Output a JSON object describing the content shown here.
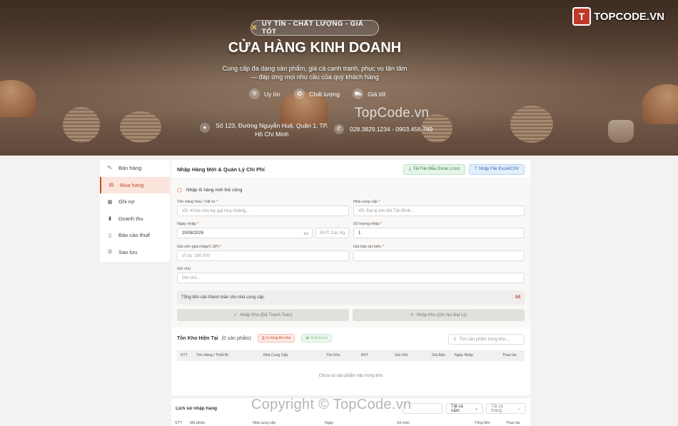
{
  "brand": {
    "logo_mark": "T",
    "logo_text": "TOPCODE.VN",
    "hero_watermark": "TopCode.vn",
    "footer_watermark": "Copyright © TopCode.vn"
  },
  "hero": {
    "tagline": "UY TÍN - CHẤT LƯỢNG - GIÁ TỐT",
    "title": "CỬA HÀNG KINH DOANH",
    "description": "Cung cấp đa dạng sản phẩm, giá cả cạnh tranh, phục vụ tận tâm — đáp ứng mọi nhu cầu của quý khách hàng",
    "badges": [
      {
        "label": "Uy tín",
        "icon": "shield-icon"
      },
      {
        "label": "Chất lượng",
        "icon": "medal-icon"
      },
      {
        "label": "Giá tốt",
        "icon": "truck-icon"
      }
    ],
    "address": "Số 123, Đường Nguyễn Huệ, Quận 1, TP. Hồ Chí Minh",
    "phone": "028.3829.1234 - 0903.456.789"
  },
  "sidebar": {
    "items": [
      {
        "label": "Bán hàng",
        "icon": "cart-icon",
        "active": false
      },
      {
        "label": "Mua hàng",
        "icon": "receipt-icon",
        "active": true
      },
      {
        "label": "Ghi nợ",
        "icon": "ledger-icon",
        "active": false
      },
      {
        "label": "Doanh thu",
        "icon": "bar-chart-icon",
        "active": false
      },
      {
        "label": "Báo cáo thuế",
        "icon": "book-icon",
        "active": false
      },
      {
        "label": "Sao lưu",
        "icon": "database-icon",
        "active": false
      }
    ]
  },
  "main": {
    "title": "Nhập Hàng Mới & Quản Lý Chi Phí",
    "download_template": "Tải File Mẫu Excel (.csv)",
    "import_file": "Nhập File Excel/CSV",
    "section_title": "Nhập lô hàng mới thủ công",
    "fields": {
      "product_name": {
        "label": "Tên hàng hóa / Vật tư",
        "placeholder": "VD: Khóa cửa tay gạt Huy Hoàng..."
      },
      "supplier": {
        "label": "Nhà cung cấp",
        "placeholder": "VD: Đại lý kim khí Tân Bình..."
      },
      "import_date": {
        "label": "Ngày nhập",
        "value": "20/08/2026"
      },
      "unit": {
        "placeholder": "ĐVT: Cái, Kg"
      },
      "quantity": {
        "label": "Số lượng nhập",
        "value": "1"
      },
      "cost_price": {
        "label": "Giá vốn (giá nhập/1 SP)",
        "placeholder": "Ví dụ: 150.000"
      },
      "sale_price": {
        "label": "Giá bán dự kiến"
      },
      "note": {
        "label": "Ghi chú",
        "placeholder": "Ghi chú..."
      }
    },
    "required_mark": "*",
    "total_label": "Tổng tiền cần thanh toán cho nhà cung cấp:",
    "total_value": "0đ",
    "btn_paid": "Nhập Kho (Đã Thanh Toán)",
    "btn_debt": "Nhập Kho (Ghi Nợ Đại Lý)"
  },
  "stock": {
    "title": "Tồn Kho Hiện Tại",
    "count": "(0 sản phẩm)",
    "print_btn": "In hàng tồn kho",
    "excel_btn": "Xuất Excel",
    "search_placeholder": "Tìm sản phẩm trong kho...",
    "columns": [
      "STT",
      "Tên Hàng / Thiết Bị",
      "Nhà Cung Cấp",
      "Tồn Kho",
      "ĐVT",
      "Giá Vốn",
      "Giá Bán",
      "Ngày Nhập",
      "Thao tác"
    ],
    "empty_text": "Chưa có sản phẩm nào trong kho"
  },
  "history": {
    "title": "Lịch sử nhập hàng",
    "year_select": "Tất cả năm",
    "month_select": "Tất cả tháng",
    "search_placeholder": "",
    "columns": [
      "STT",
      "Mã phiếu",
      "Nhà cung cấp",
      "Ngày",
      "Số món",
      "Tổng tiền",
      "Thao tác"
    ]
  },
  "colors": {
    "accent": "#c24b2c",
    "active_bg": "#fbe5dd"
  }
}
